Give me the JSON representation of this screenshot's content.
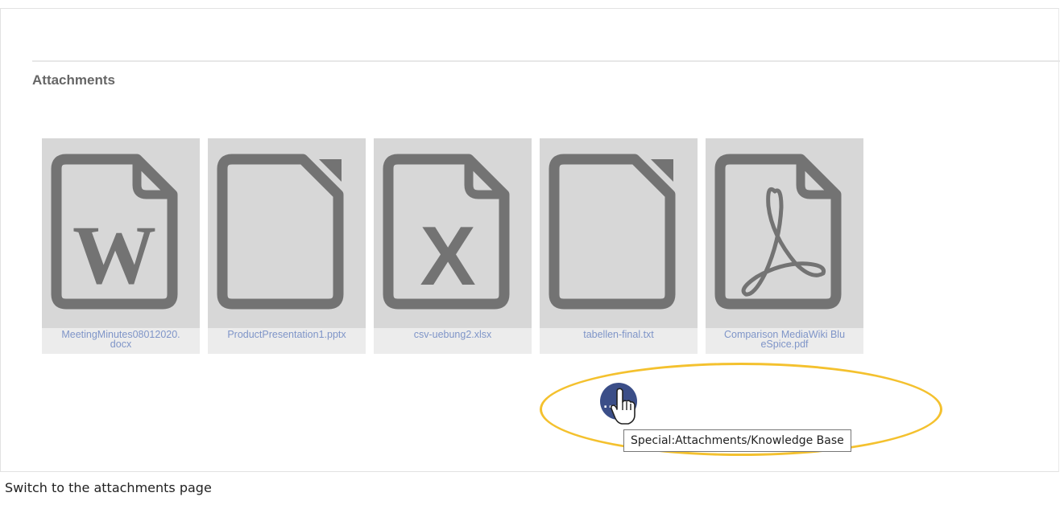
{
  "section": {
    "title": "Attachments"
  },
  "attachments": [
    {
      "filename": "MeetingMinutes08012020.docx",
      "caption_line1": "MeetingMinutes08012020.",
      "caption_line2": "docx",
      "icon": "word-document-icon"
    },
    {
      "filename": "ProductPresentation1.pptx",
      "caption_line1": "ProductPresentation1.pptx",
      "caption_line2": "",
      "icon": "blank-document-icon"
    },
    {
      "filename": "csv-uebung2.xlsx",
      "caption_line1": "csv-uebung2.xlsx",
      "caption_line2": "",
      "icon": "excel-document-icon"
    },
    {
      "filename": "tabellen-final.txt",
      "caption_line1": "tabellen-final.txt",
      "caption_line2": "",
      "icon": "blank-document-icon"
    },
    {
      "filename": "Comparison MediaWiki BlueSpice.pdf",
      "caption_line1": "Comparison MediaWiki Blu",
      "caption_line2": "eSpice.pdf",
      "icon": "pdf-document-icon"
    }
  ],
  "more_button": {
    "label": "...",
    "icon": "more-dots-icon",
    "color": "#3b4e88"
  },
  "tooltip": {
    "text": "Special:Attachments/Knowledge Base"
  },
  "highlight": {
    "color": "#f4c12e"
  },
  "caption": {
    "text": "Switch to the attachments page"
  }
}
